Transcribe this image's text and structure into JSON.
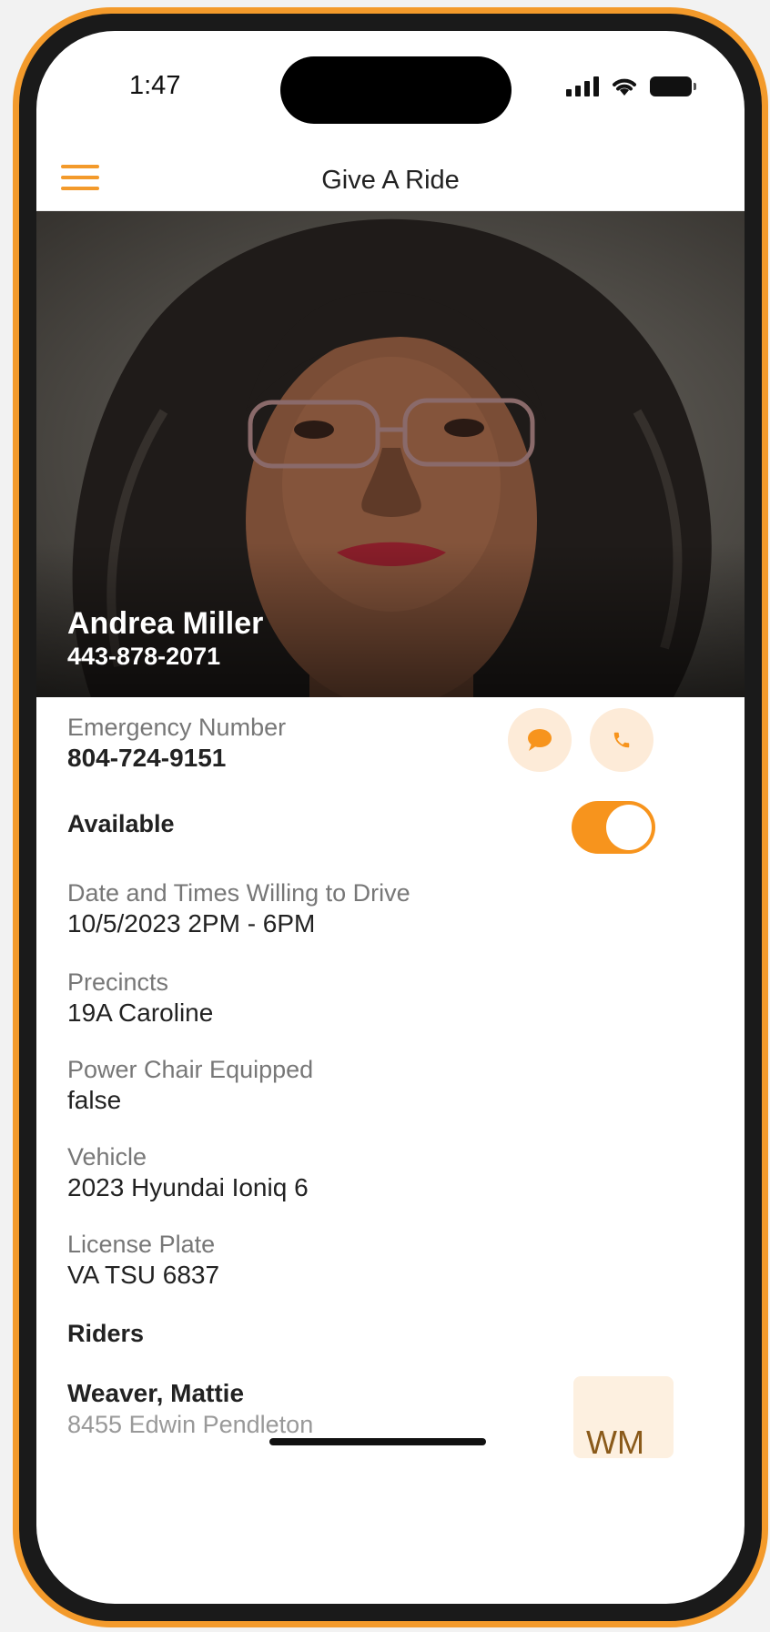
{
  "status_bar": {
    "time": "1:47"
  },
  "header": {
    "title": "Give A Ride"
  },
  "profile": {
    "name": "Andrea Miller",
    "phone": "443-878-2071"
  },
  "emergency": {
    "label": "Emergency Number",
    "value": "804-724-9151"
  },
  "availability": {
    "label": "Available",
    "enabled": true
  },
  "schedule": {
    "label": "Date and Times Willing to Drive",
    "value": "10/5/2023 2PM - 6PM"
  },
  "precincts": {
    "label": "Precincts",
    "value": "19A Caroline"
  },
  "power_chair": {
    "label": "Power Chair Equipped",
    "value": "false"
  },
  "vehicle": {
    "label": "Vehicle",
    "value": "2023 Hyundai Ioniq 6"
  },
  "license": {
    "label": "License Plate",
    "value": "VA TSU 6837"
  },
  "riders": {
    "heading": "Riders",
    "items": [
      {
        "name": "Weaver, Mattie",
        "address": "8455 Edwin Pendleton",
        "initials": "WM"
      }
    ]
  },
  "colors": {
    "accent": "#f7941d",
    "accent_light": "#fdebd8",
    "frame": "#f39a2b"
  }
}
